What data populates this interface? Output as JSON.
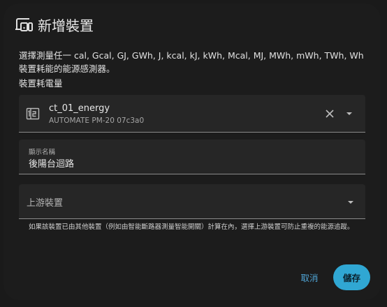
{
  "dialog": {
    "title": "新增裝置",
    "icon": "devices-icon",
    "description": "選擇測量任一 cal, Gcal, GJ, GWh, J, kcal, kJ, kWh, Mcal, MJ, MWh, mWh, TWh, Wh 裝置耗能的能源感測器。",
    "field_label": "裝置耗電量"
  },
  "entity_picker": {
    "icon": "meter-icon",
    "name": "ct_01_energy",
    "subtitle": "AUTOMATE PM-20 07c3a0"
  },
  "display_name": {
    "label": "顯示名稱",
    "value": "後陽台迴路"
  },
  "upstream": {
    "label": "上游裝置",
    "helper": "如果該裝置已由其他裝置（例如由智能斷路器測量智能開關）計算在內，選擇上游裝置可防止重複的能源追蹤。"
  },
  "actions": {
    "cancel_label": "取消",
    "save_label": "儲存"
  },
  "colors": {
    "accent": "#30a7d3",
    "background": "#1c1c1c",
    "field": "#262626"
  }
}
